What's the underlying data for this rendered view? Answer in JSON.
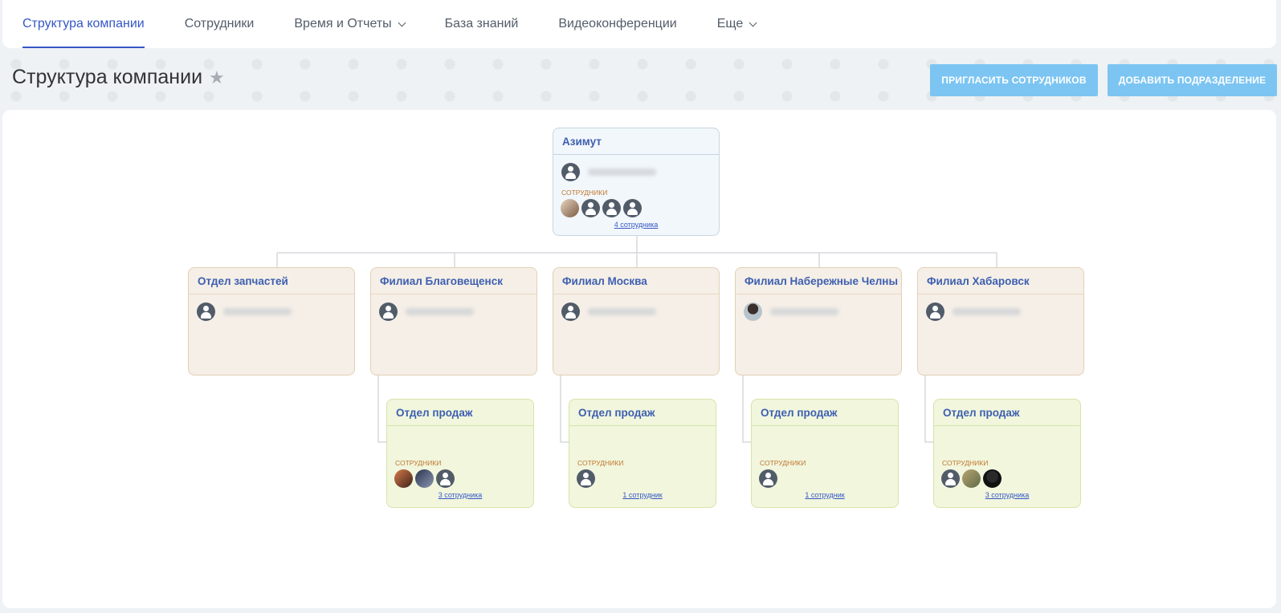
{
  "nav": {
    "tabs": [
      {
        "label": "Структура компании",
        "active": true
      },
      {
        "label": "Сотрудники"
      },
      {
        "label": "Время и Отчеты",
        "dropdown": true
      },
      {
        "label": "База знаний"
      },
      {
        "label": "Видеоконференции"
      },
      {
        "label": "Еще",
        "dropdown": true
      }
    ]
  },
  "header": {
    "title": "Структура компании",
    "invite_button": "ПРИГЛАСИТЬ СОТРУДНИКОВ",
    "add_button": "ДОБАВИТЬ ПОДРАЗДЕЛЕНИЕ"
  },
  "colors": {
    "accent": "#3657c6",
    "button": "#7cc5f2",
    "root_bg": "#f2f7fb",
    "dept_bg": "#f5efe7",
    "sub_bg": "#f1f6dd"
  },
  "structure": {
    "employees_label": "СОТРУДНИКИ",
    "root": {
      "name": "Азимут",
      "employees_link": "4 сотрудника"
    },
    "departments": [
      {
        "name": "Отдел запчастей"
      },
      {
        "name": "Филиал Благовещенск"
      },
      {
        "name": "Филиал Москва"
      },
      {
        "name": "Филиал Набережные Челны"
      },
      {
        "name": "Филиал Хабаровск"
      }
    ],
    "subdepartments": [
      {
        "name": "Отдел продаж",
        "employees_link": "3 сотрудника"
      },
      {
        "name": "Отдел продаж",
        "employees_link": "1 сотрудник"
      },
      {
        "name": "Отдел продаж",
        "employees_link": "1 сотрудник"
      },
      {
        "name": "Отдел продаж",
        "employees_link": "3 сотрудника"
      }
    ]
  }
}
